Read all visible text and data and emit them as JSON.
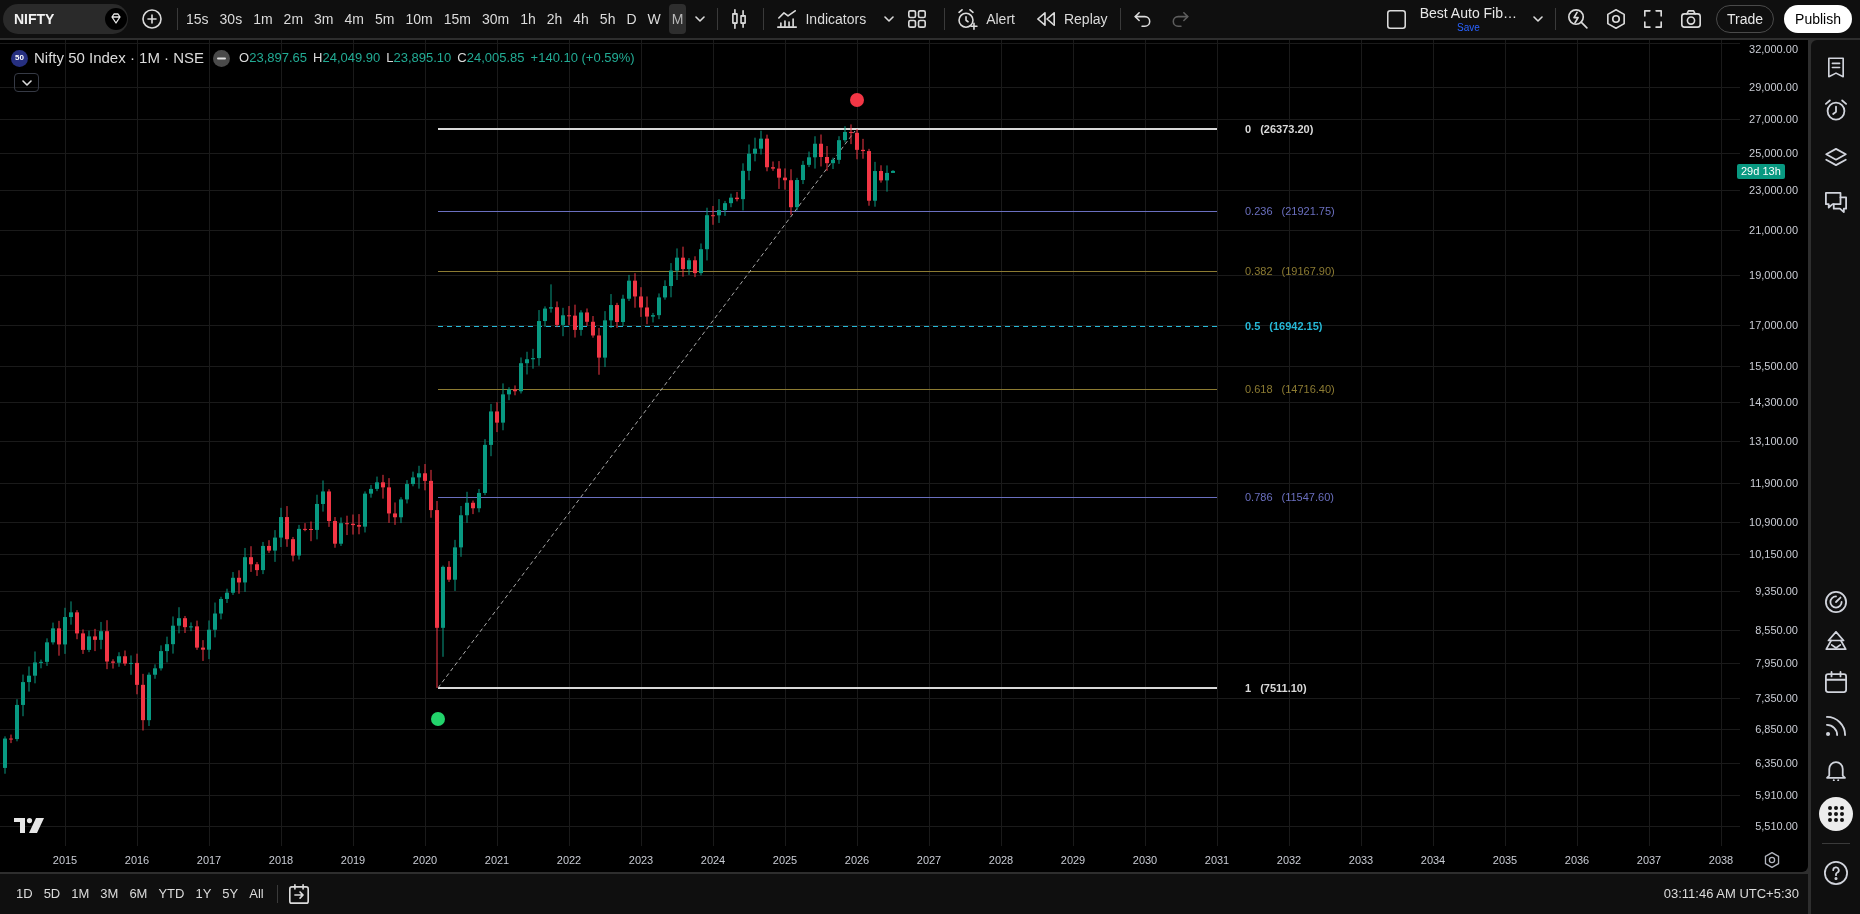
{
  "toolbar": {
    "symbol": "NIFTY",
    "timeframes": [
      {
        "label": "15s",
        "selected": false
      },
      {
        "label": "30s",
        "selected": false
      },
      {
        "label": "1m",
        "selected": false
      },
      {
        "label": "2m",
        "selected": false
      },
      {
        "label": "3m",
        "selected": false
      },
      {
        "label": "4m",
        "selected": false
      },
      {
        "label": "5m",
        "selected": false
      },
      {
        "label": "10m",
        "selected": false
      },
      {
        "label": "15m",
        "selected": false
      },
      {
        "label": "30m",
        "selected": false
      },
      {
        "label": "1h",
        "selected": false
      },
      {
        "label": "2h",
        "selected": false
      },
      {
        "label": "4h",
        "selected": false
      },
      {
        "label": "5h",
        "selected": false
      },
      {
        "label": "D",
        "selected": false
      },
      {
        "label": "W",
        "selected": false
      },
      {
        "label": "M",
        "selected": true
      }
    ],
    "indicators_button": "Indicators",
    "alert_button": "Alert",
    "replay_button": "Replay",
    "undo": {
      "disabled": false
    },
    "redo": {
      "disabled": true
    },
    "layout": {
      "name": "Best Auto Fib…",
      "status": "Save"
    },
    "trade_button": "Trade",
    "publish_button": "Publish"
  },
  "legend": {
    "badge": "50",
    "title": "Nifty 50 Index · 1M · NSE",
    "ohlc": [
      {
        "label": "O",
        "value": "23,897.65"
      },
      {
        "label": "H",
        "value": "24,049.90"
      },
      {
        "label": "L",
        "value": "23,895.10"
      },
      {
        "label": "C",
        "value": "24,005.85"
      }
    ],
    "change": "+140.10 (+0.59%)"
  },
  "chart": {
    "fib_levels": [
      {
        "ratio": "0",
        "price": "(26373.20)",
        "color": "#d9d9d9",
        "kind": "main"
      },
      {
        "ratio": "0.236",
        "price": "(21921.75)",
        "color": "#6a6fbf",
        "kind": "minor"
      },
      {
        "ratio": "0.382",
        "price": "(19167.90)",
        "color": "#8c7b32",
        "kind": "minor"
      },
      {
        "ratio": "0.5",
        "price": "(16942.15)",
        "color": "#26b8d6",
        "kind": "dashed"
      },
      {
        "ratio": "0.618",
        "price": "(14716.40)",
        "color": "#8c7b32",
        "kind": "minor"
      },
      {
        "ratio": "0.786",
        "price": "(11547.60)",
        "color": "#6a6fbf",
        "kind": "minor"
      },
      {
        "ratio": "1",
        "price": "(7511.10)",
        "color": "#d9d9d9",
        "kind": "main"
      }
    ],
    "pivots": [
      {
        "kind": "high",
        "color": "#f23645"
      },
      {
        "kind": "low",
        "color": "#22d36b"
      }
    ],
    "price_axis": [
      "32,000.00",
      "29,000.00",
      "27,000.00",
      "25,000.00",
      "23,000.00",
      "21,000.00",
      "19,000.00",
      "17,000.00",
      "15,500.00",
      "14,300.00",
      "13,100.00",
      "11,900.00",
      "10,900.00",
      "10,150.00",
      "9,350.00",
      "8,550.00",
      "7,950.00",
      "7,350.00",
      "6,850.00",
      "6,350.00",
      "5,910.00",
      "5,510.00"
    ],
    "countdown": "29d 13h",
    "time_axis": [
      "2015",
      "2016",
      "2017",
      "2018",
      "2019",
      "2020",
      "2021",
      "2022",
      "2023",
      "2024",
      "2025",
      "2026",
      "2027",
      "2028",
      "2029",
      "2030",
      "2031",
      "2032",
      "2033",
      "2034",
      "2035",
      "2036",
      "2037",
      "2038"
    ]
  },
  "bottom_bar": {
    "ranges": [
      "1D",
      "5D",
      "1M",
      "3M",
      "6M",
      "YTD",
      "1Y",
      "5Y",
      "All"
    ],
    "clock": "03:11:46 AM UTC+5:30"
  }
}
